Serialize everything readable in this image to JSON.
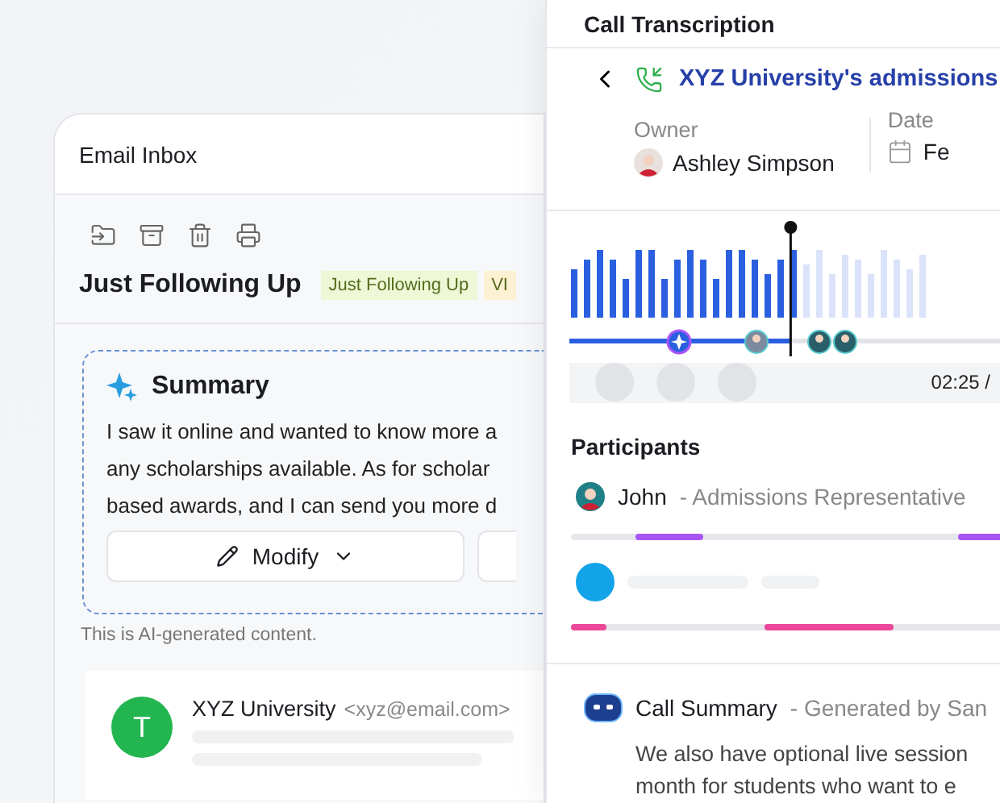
{
  "email_window": {
    "title": "Email Inbox",
    "toolbar": [
      {
        "kind": "folder"
      },
      {
        "kind": "archive"
      },
      {
        "kind": "trash"
      },
      {
        "kind": "print"
      }
    ],
    "subject": "Just Following Up",
    "tags": [
      {
        "label": "Just Following Up",
        "color": "#eef8d6"
      },
      {
        "label": "VI",
        "color": "#fdf1d3"
      }
    ],
    "summary": {
      "title": "Summary",
      "lines": [
        "I saw it online and wanted to know more a",
        "any scholarships available. As for scholar",
        "based awards, and I can send you more d"
      ],
      "button": "Modify"
    },
    "disclaimer": "This is AI-generated content.",
    "message": {
      "avatar": "T",
      "sender": "XYZ University",
      "address": "<xyz@email.com>"
    }
  },
  "call_window": {
    "title": "Call Transcription",
    "call_title": "XYZ University's admissions",
    "owner_label": "Owner",
    "owner": "Ashley Simpson",
    "date_label": "Date",
    "date": "Fe",
    "playback": {
      "level": 0.49,
      "time": "02:25 /"
    },
    "participants_title": "Participants",
    "participants": [
      {
        "name": "John",
        "role": "- Admissions Representative",
        "color": "#a855f7",
        "kind": "photo"
      },
      {
        "color": "#ec4899",
        "kind": "plain"
      }
    ],
    "summary": {
      "title": "Call Summary",
      "byline": "- Generated by San",
      "lines": [
        "We also have optional live session",
        "month for students who want to e"
      ]
    }
  }
}
